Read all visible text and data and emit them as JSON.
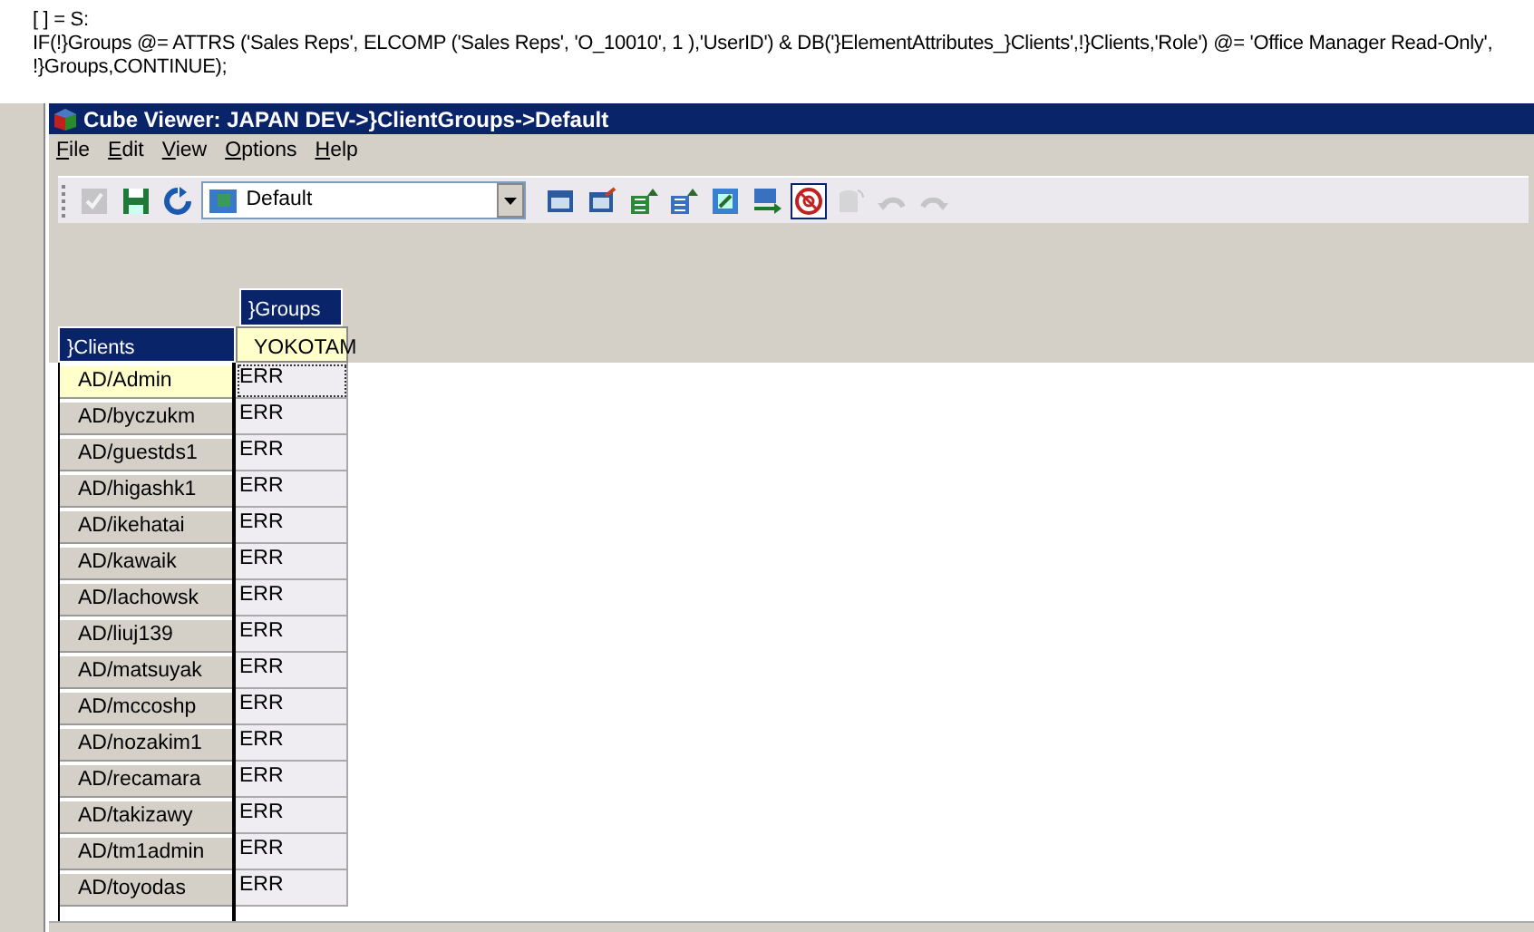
{
  "formula": [
    "[ ] = S:",
    "IF(!}Groups @= ATTRS ('Sales Reps', ELCOMP ('Sales Reps', 'O_10010', 1 ),'UserID') & DB('}ElementAttributes_}Clients',!}Clients,'Role') @= 'Office Manager Read-Only',",
    "!}Groups,CONTINUE);"
  ],
  "window": {
    "title": "Cube Viewer: JAPAN DEV->}ClientGroups->Default"
  },
  "menu": [
    {
      "label": "File"
    },
    {
      "label": "Edit"
    },
    {
      "label": "View"
    },
    {
      "label": "Options"
    },
    {
      "label": "Help"
    }
  ],
  "toolbar_left": [
    {
      "kind": "check",
      "disabled": true,
      "pressed": false
    },
    {
      "kind": "save",
      "disabled": false,
      "pressed": false
    },
    {
      "kind": "refresh",
      "disabled": false,
      "pressed": false
    }
  ],
  "view_select": {
    "value": "Default"
  },
  "toolbar_right": [
    {
      "kind": "calc",
      "disabled": false,
      "pressed": false
    },
    {
      "kind": "recalc",
      "disabled": false,
      "pressed": false
    },
    {
      "kind": "sheet",
      "disabled": false,
      "pressed": false
    },
    {
      "kind": "grid",
      "disabled": false,
      "pressed": false
    },
    {
      "kind": "zoom",
      "disabled": false,
      "pressed": false
    },
    {
      "kind": "arrow",
      "disabled": false,
      "pressed": false
    },
    {
      "kind": "suppress",
      "disabled": false,
      "pressed": true
    },
    {
      "kind": "db",
      "disabled": true,
      "pressed": false
    },
    {
      "kind": "undo",
      "disabled": true,
      "pressed": false
    },
    {
      "kind": "redo",
      "disabled": true,
      "pressed": false
    }
  ],
  "grid": {
    "column_dimension": "}Groups",
    "row_dimension": "}Clients",
    "columns": [
      "YOKOTAM"
    ],
    "rows": [
      {
        "label": "AD/Admin",
        "selected": true,
        "cells": [
          "ERR"
        ]
      },
      {
        "label": "AD/byczukm",
        "selected": false,
        "cells": [
          "ERR"
        ]
      },
      {
        "label": "AD/guestds1",
        "selected": false,
        "cells": [
          "ERR"
        ]
      },
      {
        "label": "AD/higashk1",
        "selected": false,
        "cells": [
          "ERR"
        ]
      },
      {
        "label": "AD/ikehatai",
        "selected": false,
        "cells": [
          "ERR"
        ]
      },
      {
        "label": "AD/kawaik",
        "selected": false,
        "cells": [
          "ERR"
        ]
      },
      {
        "label": "AD/lachowsk",
        "selected": false,
        "cells": [
          "ERR"
        ]
      },
      {
        "label": "AD/liuj139",
        "selected": false,
        "cells": [
          "ERR"
        ]
      },
      {
        "label": "AD/matsuyak",
        "selected": false,
        "cells": [
          "ERR"
        ]
      },
      {
        "label": "AD/mccoshp",
        "selected": false,
        "cells": [
          "ERR"
        ]
      },
      {
        "label": "AD/nozakim1",
        "selected": false,
        "cells": [
          "ERR"
        ]
      },
      {
        "label": "AD/recamara",
        "selected": false,
        "cells": [
          "ERR"
        ]
      },
      {
        "label": "AD/takizawy",
        "selected": false,
        "cells": [
          "ERR"
        ]
      },
      {
        "label": "AD/tm1admin",
        "selected": false,
        "cells": [
          "ERR"
        ]
      },
      {
        "label": "AD/toyodas",
        "selected": false,
        "cells": [
          "ERR"
        ]
      }
    ]
  }
}
